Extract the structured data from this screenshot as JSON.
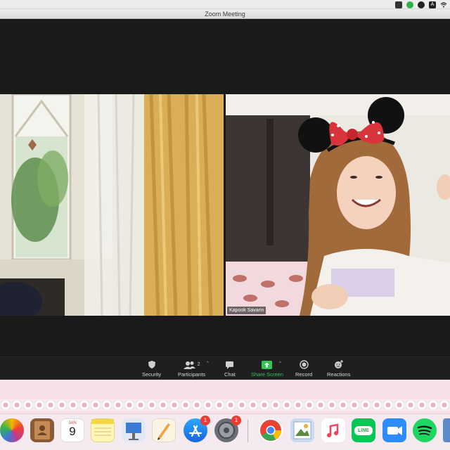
{
  "window": {
    "title": "Zoom Meeting"
  },
  "participants_tiles": [
    {
      "name": ""
    },
    {
      "name": "Kapook Savarin"
    }
  ],
  "toolbar": {
    "security": "Security",
    "participants": "Participants",
    "participant_count": "2",
    "chat": "Chat",
    "share_screen": "Share Screen",
    "record": "Record",
    "reactions": "Reactions"
  },
  "dock": {
    "calendar_month": "JAN",
    "calendar_day": "9",
    "app_store_badge": "1",
    "system_prefs_badge": "1",
    "line_label": "LINE"
  },
  "colors": {
    "share_green": "#30c757",
    "badge_red": "#ec3b30",
    "zoom_blue": "#2d8cff",
    "line_green": "#06c755",
    "spotify_green": "#1ed760"
  }
}
